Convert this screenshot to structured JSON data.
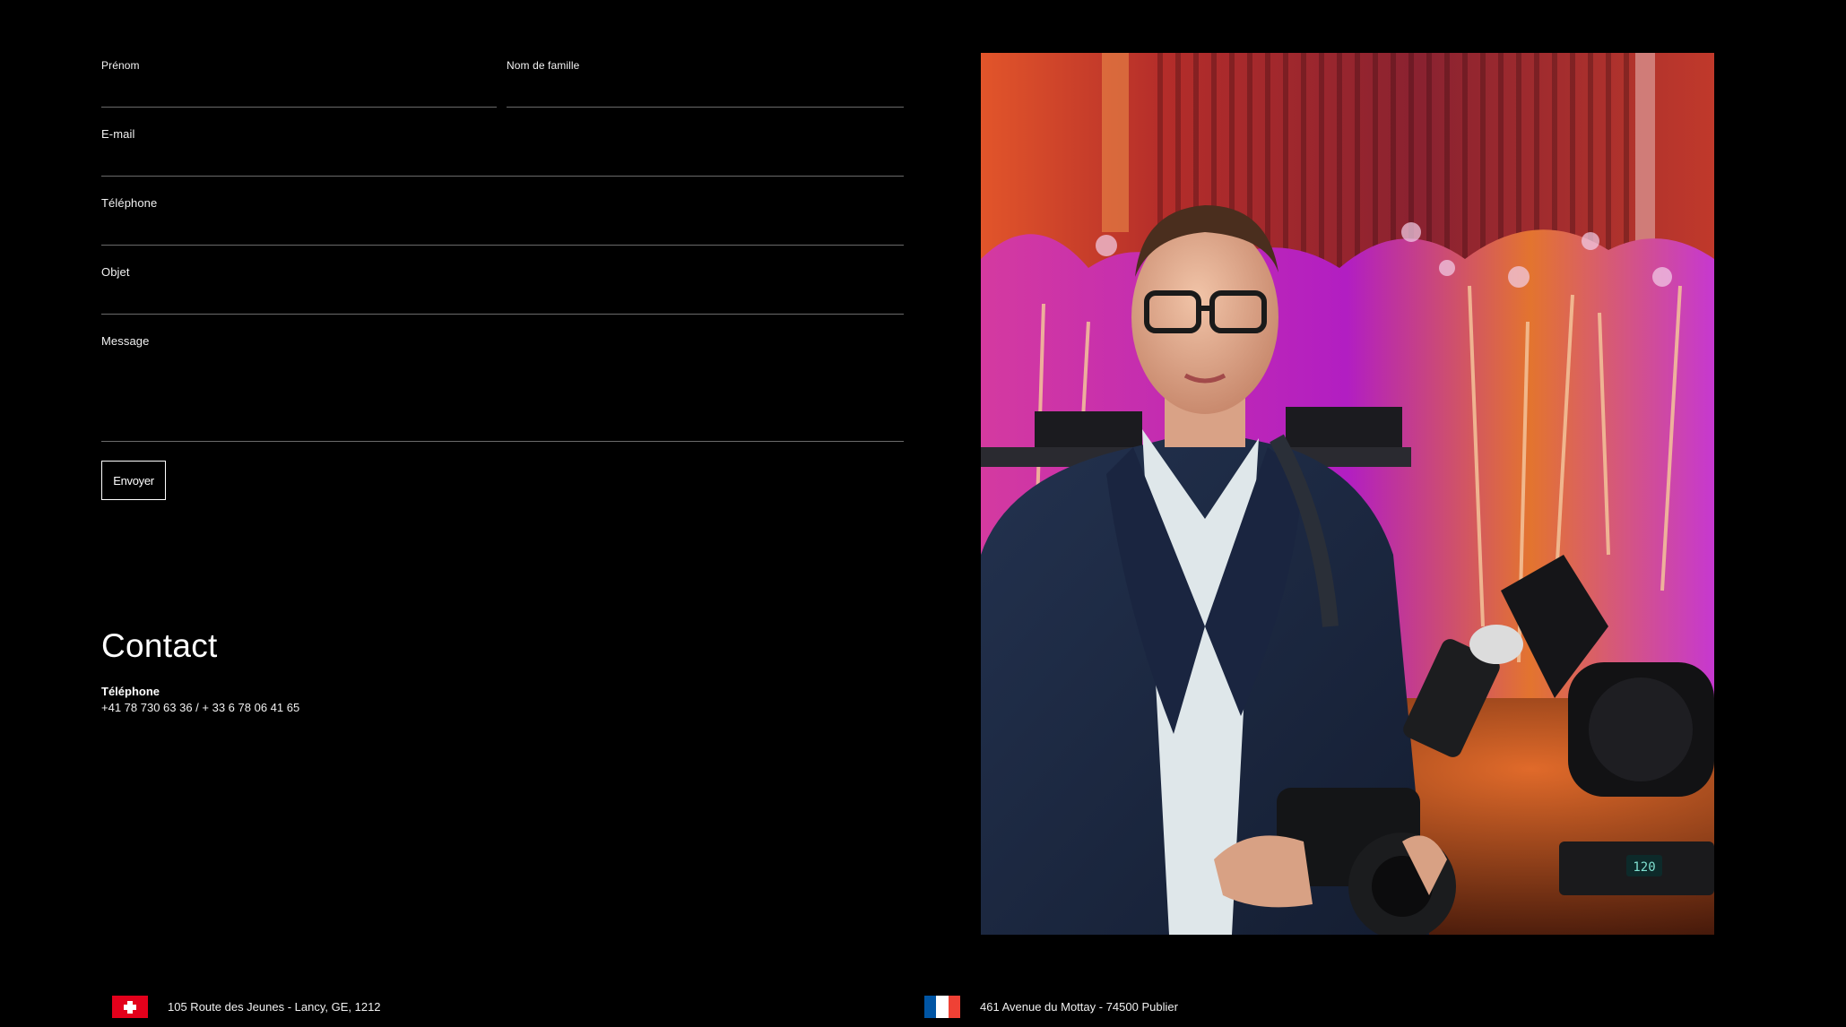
{
  "form": {
    "first_name_label": "Prénom",
    "last_name_label": "Nom de famille",
    "email_label": "E-mail",
    "phone_label": "Téléphone",
    "subject_label": "Objet",
    "message_label": "Message",
    "first_name_value": "",
    "last_name_value": "",
    "email_value": "",
    "phone_value": "",
    "subject_value": "",
    "message_value": "",
    "submit_label": "Envoyer"
  },
  "contact": {
    "title": "Contact",
    "phone_label": "Téléphone",
    "phone_value": "+41 78 730 63 36 / + 33 6 78 06 41 65"
  },
  "addresses": {
    "switzerland": "105 Route des Jeunes - Lancy, GE, 1212",
    "france": "461 Avenue du Mottay - 74500 Publier"
  },
  "photo": {
    "display_readout": "120"
  },
  "colors": {
    "background": "#000000",
    "text": "#ffffff",
    "input_line": "#6a6a6a",
    "swiss_red": "#e3001b",
    "french_blue": "#0055a4",
    "french_white": "#ffffff",
    "french_red": "#ef4135"
  },
  "icons": {
    "swiss_flag": "switzerland-flag-icon",
    "french_flag": "france-flag-icon"
  }
}
